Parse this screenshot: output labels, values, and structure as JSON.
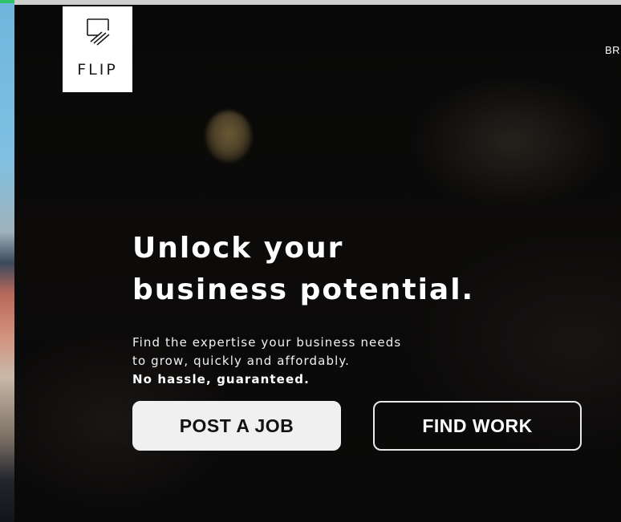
{
  "brand": {
    "name": "FLIP"
  },
  "nav": {
    "peek_label": "BR"
  },
  "hero": {
    "headline_line1": "Unlock your",
    "headline_line2": "business potential.",
    "sub_line1": "Find the expertise your business needs",
    "sub_line2": "to grow, quickly and affordably.",
    "sub_line3": "No hassle, guaranteed."
  },
  "actions": {
    "post_job_label": "POST A JOB",
    "find_work_label": "FIND WORK"
  },
  "icons": {
    "logo": "flip-logo-icon"
  },
  "colors": {
    "accent_green": "#2fc46b",
    "hero_background": "#080808",
    "primary_button": "#f0f0f0",
    "text": "#ffffff"
  }
}
